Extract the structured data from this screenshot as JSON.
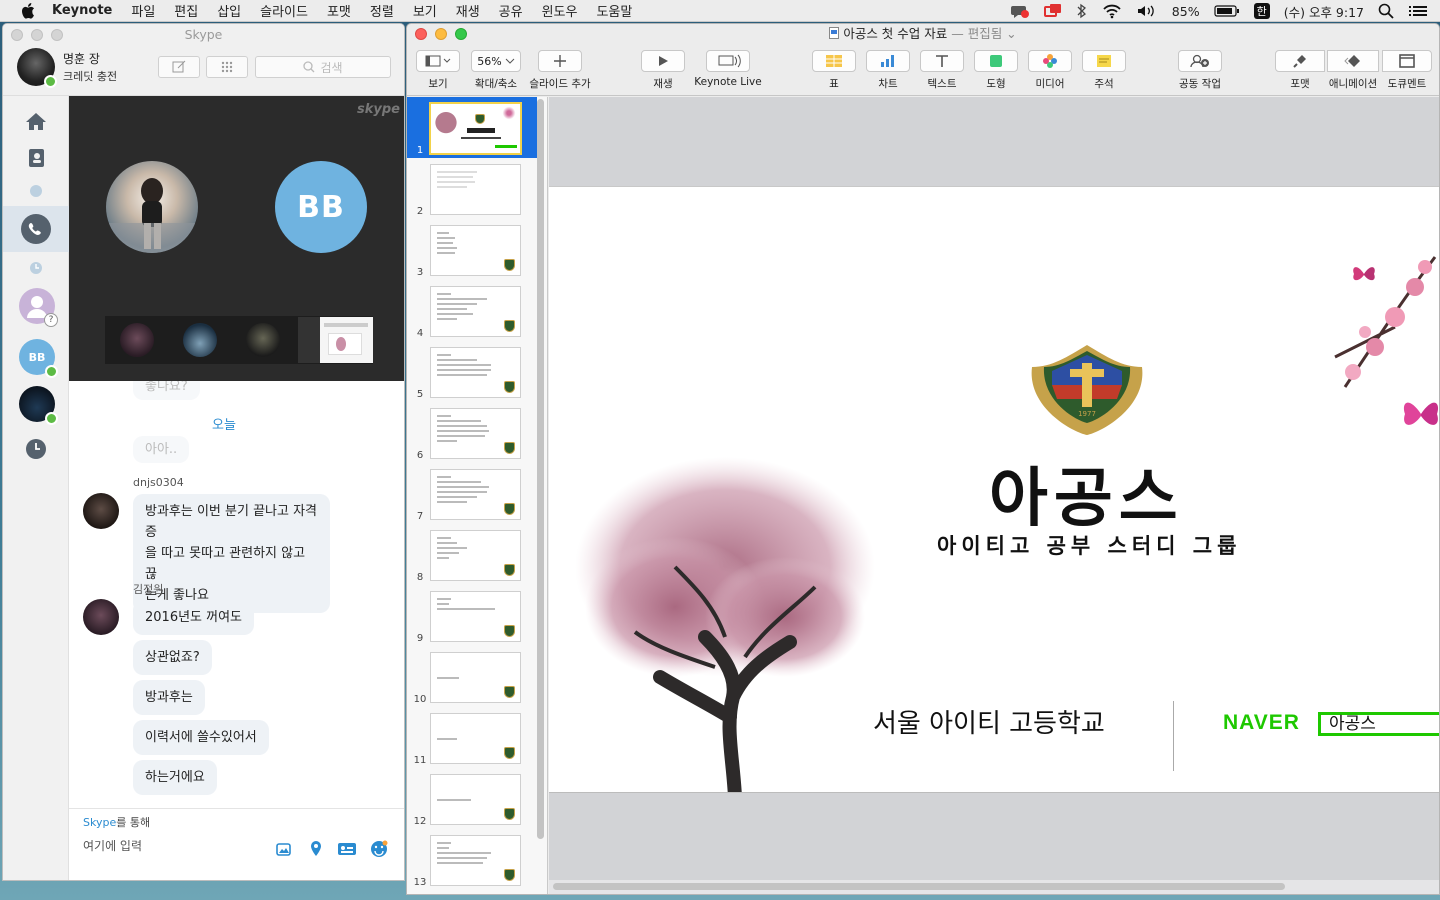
{
  "menubar": {
    "app": "Keynote",
    "items": [
      "파일",
      "편집",
      "삽입",
      "슬라이드",
      "포맷",
      "정렬",
      "보기",
      "재생",
      "공유",
      "윈도우",
      "도움말"
    ],
    "battery": "85%",
    "input_source": "한",
    "clock": "(수) 오후 9:17"
  },
  "skype": {
    "window_title": "Skype",
    "user_name": "명훈 장",
    "credit_label": "크레딧 충전",
    "search_placeholder": "검색",
    "call": {
      "logo": "skype",
      "participant2_initials": "BB"
    },
    "contacts": [
      {
        "initials": "BB"
      }
    ],
    "chat": {
      "date_separator": "오늘",
      "faded_messages": [
        "좋나요?",
        "아아.."
      ],
      "messages": [
        {
          "sender": "dnjs0304",
          "lines": [
            "방과후는 이번 분기 끝나고 자격증",
            "을 따고 못따고 관련하지 않고 끊",
            "는게 좋나요"
          ]
        },
        {
          "sender": "김정원",
          "bubbles": [
            "2016년도 꺼여도",
            "상관없죠?",
            "방과후는",
            "이력서에 쓸수있어서",
            "하는거에요"
          ]
        }
      ]
    },
    "composer": {
      "via_brand": "Skype",
      "via_suffix": "를 통해",
      "placeholder": "여기에 입력"
    }
  },
  "keynote": {
    "document_title": "아공스 첫 수업 자료",
    "document_status": "— 편집됨 ⌄",
    "toolbar": {
      "view": "보기",
      "zoom_value": "56%",
      "zoom": "확대/축소",
      "add_slide": "슬라이드 추가",
      "play": "재생",
      "keynote_live": "Keynote Live",
      "table": "표",
      "chart": "차트",
      "text": "텍스트",
      "shape": "도형",
      "media": "미디어",
      "comment": "주석",
      "collaborate": "공동 작업",
      "format": "포맷",
      "animate": "애니메이션",
      "document": "도큐멘트"
    },
    "slide_numbers": [
      "1",
      "2",
      "3",
      "4",
      "5",
      "6",
      "7",
      "8",
      "9",
      "10",
      "11",
      "12",
      "13"
    ],
    "selected_slide": 1,
    "slide": {
      "title": "아공스",
      "subtitle": "아이티고 공부 스터디 그룹",
      "school": "서울 아이티 고등학교",
      "brand": "NAVER",
      "brand_box": "아공스",
      "crest_year": "1977"
    },
    "colors": {
      "naver_green": "#1ec800",
      "selection_blue": "#1a6fe0",
      "skype_blue": "#2a8bd0"
    }
  }
}
